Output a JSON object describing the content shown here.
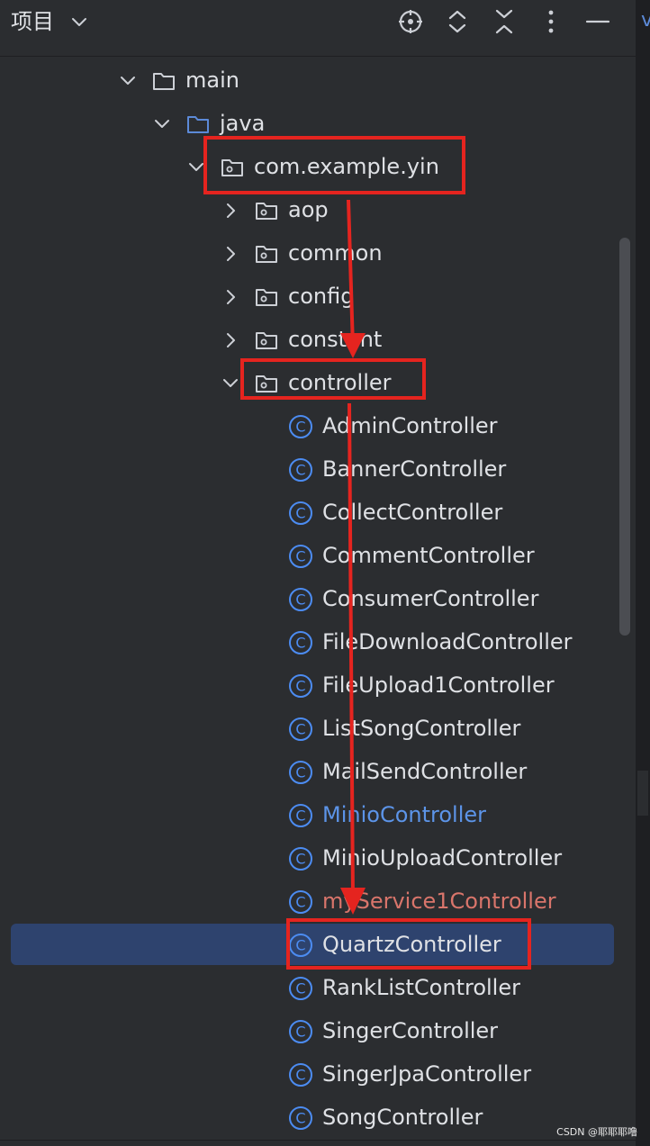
{
  "header": {
    "title": "项目",
    "chevron_icon": "chevron-down-icon",
    "buttons": [
      {
        "name": "locate-button",
        "icon": "crosshair-icon"
      },
      {
        "name": "expand-all-button",
        "icon": "expand-icon"
      },
      {
        "name": "collapse-all-button",
        "icon": "collapse-icon"
      },
      {
        "name": "options-button",
        "icon": "more-vertical-icon"
      },
      {
        "name": "hide-button",
        "icon": "minus-icon"
      }
    ]
  },
  "right_strip": {
    "label": "v"
  },
  "tree": {
    "nodes": [
      {
        "label": "main",
        "type": "folder",
        "expanded": true
      },
      {
        "label": "java",
        "type": "source-folder",
        "expanded": true
      },
      {
        "label": "com.example.yin",
        "type": "package",
        "expanded": true
      },
      {
        "label": "aop",
        "type": "package",
        "expanded": false
      },
      {
        "label": "common",
        "type": "package",
        "expanded": false
      },
      {
        "label": "config",
        "type": "package",
        "expanded": false
      },
      {
        "label": "constant",
        "type": "package",
        "expanded": false
      },
      {
        "label": "controller",
        "type": "package",
        "expanded": true
      },
      {
        "label": "AdminController",
        "type": "class"
      },
      {
        "label": "BannerController",
        "type": "class"
      },
      {
        "label": "CollectController",
        "type": "class"
      },
      {
        "label": "CommentController",
        "type": "class"
      },
      {
        "label": "ConsumerController",
        "type": "class"
      },
      {
        "label": "FileDownloadController",
        "type": "class"
      },
      {
        "label": "FileUpload1Controller",
        "type": "class"
      },
      {
        "label": "ListSongController",
        "type": "class"
      },
      {
        "label": "MailSendController",
        "type": "class"
      },
      {
        "label": "MinioController",
        "type": "class",
        "status": "modified"
      },
      {
        "label": "MinioUploadController",
        "type": "class"
      },
      {
        "label": "myService1Controller",
        "type": "class",
        "status": "error"
      },
      {
        "label": "QuartzController",
        "type": "class",
        "selected": true
      },
      {
        "label": "RankListController",
        "type": "class"
      },
      {
        "label": "SingerController",
        "type": "class"
      },
      {
        "label": "SingerJpaController",
        "type": "class"
      },
      {
        "label": "SongController",
        "type": "class"
      }
    ]
  },
  "colors": {
    "background": "#2b2d30",
    "text": "#dfe1e5",
    "modified": "#5c94e8",
    "error": "#d9756b",
    "selection": "#2e436e",
    "annotation": "#e5241f",
    "class_icon": "#4c8cf2",
    "folder_icon": "#cdd0d6",
    "source_folder_icon": "#5c8ad8"
  },
  "watermark": "CSDN @耶耶耶噜"
}
